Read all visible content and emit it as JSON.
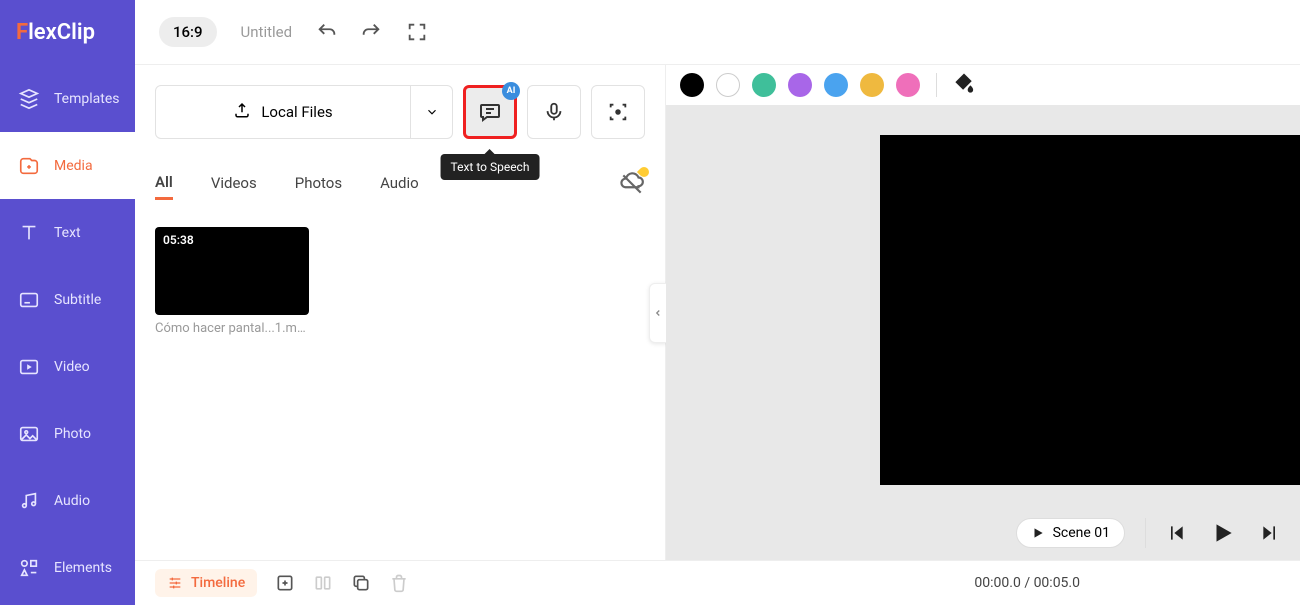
{
  "brand": {
    "lead": "F",
    "rest": "lexClip"
  },
  "sidebar": {
    "items": [
      {
        "label": "Templates"
      },
      {
        "label": "Media"
      },
      {
        "label": "Text"
      },
      {
        "label": "Subtitle"
      },
      {
        "label": "Video"
      },
      {
        "label": "Photo"
      },
      {
        "label": "Audio"
      },
      {
        "label": "Elements"
      }
    ]
  },
  "topbar": {
    "aspect": "16:9",
    "title": "Untitled"
  },
  "upload": {
    "local_files": "Local Files",
    "tts_tooltip": "Text to Speech",
    "ai_badge": "AI"
  },
  "tabs": {
    "all": "All",
    "videos": "Videos",
    "photos": "Photos",
    "audio": "Audio"
  },
  "media": {
    "items": [
      {
        "duration": "05:38",
        "filename": "Cómo hacer pantal...1.mp4"
      }
    ]
  },
  "playback": {
    "scene_label": "Scene 01"
  },
  "bottombar": {
    "timeline_label": "Timeline",
    "timecode": "00:00.0 / 00:05.0"
  },
  "colors": {
    "accent": "#f36a3e",
    "sidebar": "#5a4fcf"
  }
}
